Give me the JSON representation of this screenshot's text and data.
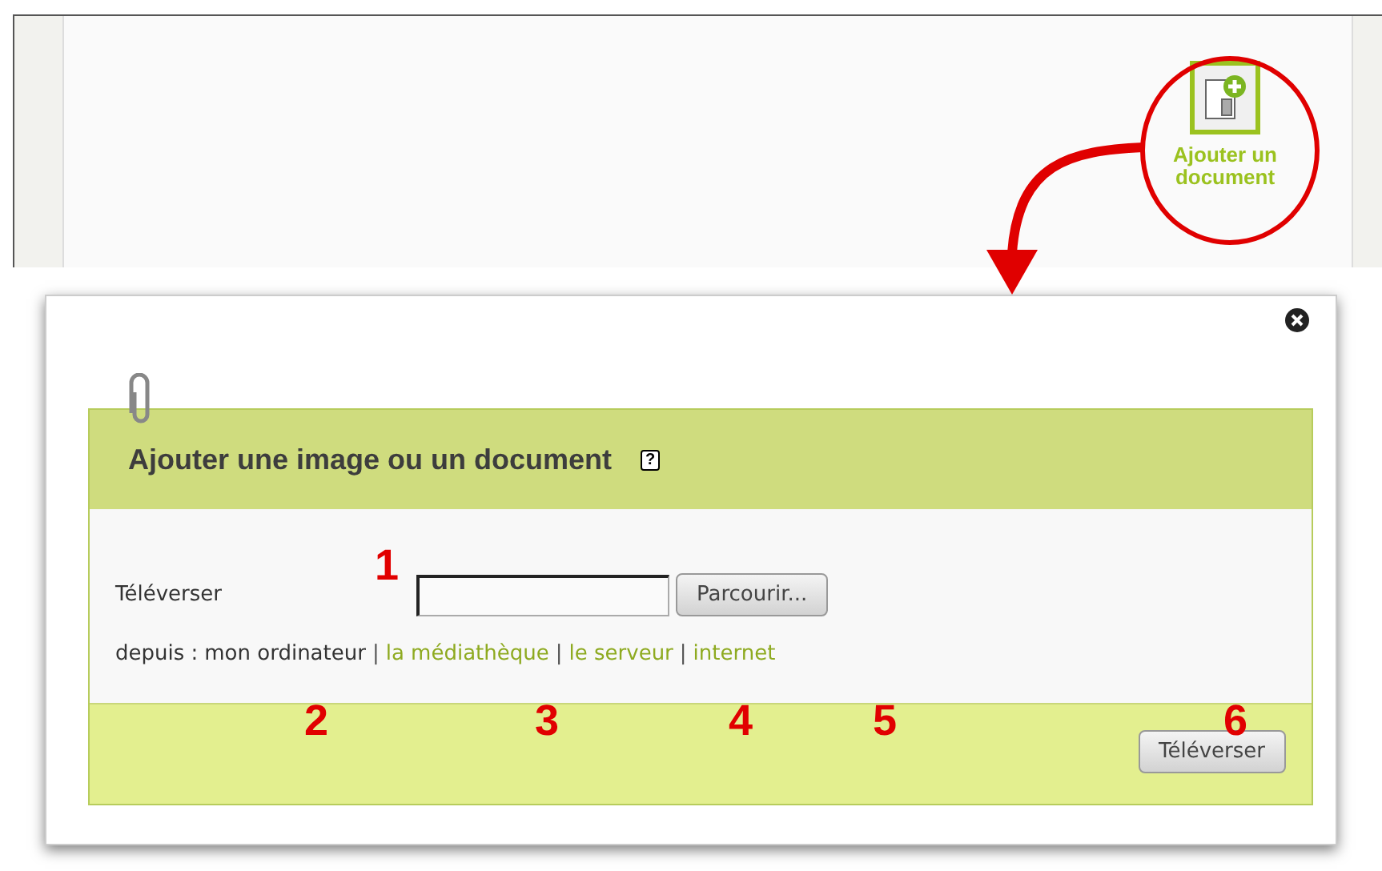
{
  "page": {
    "add_document": {
      "label": "Ajouter un document"
    }
  },
  "dialog": {
    "title": "Ajouter une image ou un document",
    "help": "?",
    "upload_label": "Téléverser",
    "browse_button": "Parcourir...",
    "sources_prefix": "depuis :",
    "sources": [
      {
        "label": "mon ordinateur",
        "selected": true
      },
      {
        "separator": "|",
        "label": "la médiathèque",
        "selected": false
      },
      {
        "separator": "|",
        "label": "le serveur",
        "selected": false
      },
      {
        "separator": "|",
        "label": "internet",
        "selected": false
      }
    ],
    "submit_button": "Téléverser"
  },
  "annotations": [
    "1",
    "2",
    "3",
    "4",
    "5",
    "6"
  ]
}
